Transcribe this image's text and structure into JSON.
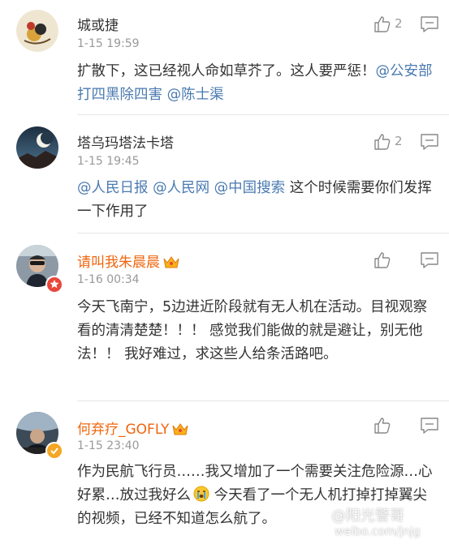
{
  "comments": [
    {
      "name": "城或捷",
      "time": "1-15 19:59",
      "likes": "2",
      "text_parts": [
        "扩散下，这已经视人命如草芥了。这人要严惩！",
        "@公安部打四黑除四害",
        " ",
        "@陈士渠"
      ]
    },
    {
      "name": "塔乌玛塔法卡塔",
      "time": "1-15 19:45",
      "likes": "2",
      "text_parts": [
        "@人民日报",
        " ",
        "@人民网",
        " ",
        "@中国搜索",
        " 这个时候需要你们发挥一下作用了"
      ]
    },
    {
      "name": "请叫我朱晨晨",
      "time": "1-16 00:34",
      "likes": "",
      "text": "今天飞南宁，5边进近阶段就有无人机在活动。目视观察看的清清楚楚！！！ 感觉我们能做的就是避让，别无他法！！ 我好难过，求这些人给条活路吧。"
    },
    {
      "name": "何弃疗_GOFLY",
      "time": "1-15 23:40",
      "likes": "",
      "text_a": "作为民航飞行员……我又增加了一个需要关注危险源…心好累…放过我好么",
      "text_b": " 今天看了一个无人机打掉打掉翼尖的视频，已经不知道怎么航了。"
    }
  ],
  "watermark": {
    "line1": "@阳光警哥",
    "line2": "weibo.com/jnjg"
  },
  "colors": {
    "mention": "#4a7ab0",
    "vip_name": "#f0650e",
    "meta": "#999999"
  }
}
